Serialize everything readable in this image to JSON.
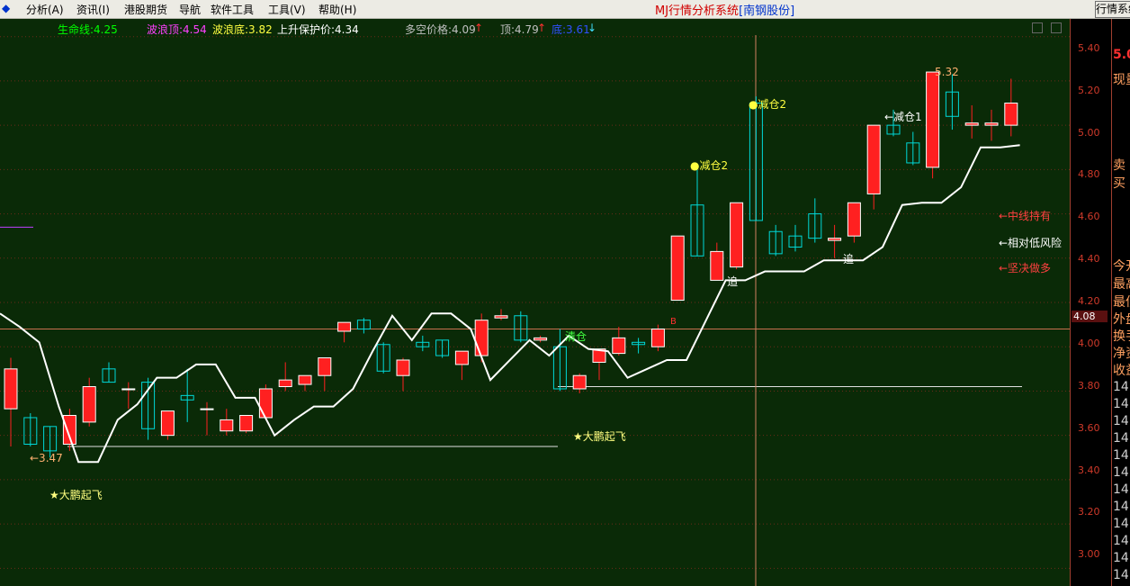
{
  "menu": {
    "items": [
      "分析(A)",
      "资讯(I)",
      "港股期货",
      "导航",
      "软件工具",
      "工具(V)",
      "帮助(H)"
    ],
    "title_system": "MJ行情分析系统",
    "title_stock": "[南钢股份]",
    "right_button": "行情系统"
  },
  "indicators": {
    "life_line": "生命线:4.25",
    "wave_top": "波浪顶:4.54",
    "wave_bottom": "波浪底:3.82",
    "protect_price": "上升保护价:4.34",
    "bull_bear": "多空价格:4.09",
    "bull_bear_arrow": "↑",
    "top": "顶:4.79",
    "top_arrow": "↑",
    "bottom": "底:3.61",
    "bottom_arrow": "↓"
  },
  "colors": {
    "background": "#0a2a07",
    "up": "#ff2020",
    "down": "#00d8d8",
    "life_line": "#ffffff",
    "grid": "#6a2a18"
  },
  "price_axis": {
    "ticks": [
      "5.40",
      "5.20",
      "5.00",
      "4.80",
      "4.60",
      "4.40",
      "4.20",
      "4.00",
      "3.80",
      "3.60",
      "3.40",
      "3.20",
      "3.00"
    ],
    "current_price": "4.08"
  },
  "annotations": {
    "low_label": "←3.47",
    "high_label": "5.32",
    "reduce2_a": "●减仓2",
    "reduce2_b": "●减仓2",
    "reduce1": "←减仓1",
    "clear_pos": "清仓",
    "chase_a": "追",
    "chase_b": "追",
    "b_marker": "B",
    "dapeng_a": "★大鹏起飞",
    "dapeng_b": "★大鹏起飞",
    "mid_hold": "←中线持有",
    "low_risk": "←相对低风险",
    "go_long": "←坚决做多"
  },
  "side_panel": {
    "items": [
      "5.0",
      "现量",
      "卖",
      "买",
      "今开",
      "最高",
      "最低",
      "外盘",
      "换手",
      "净资",
      "收益",
      "14:",
      "14:",
      "14:",
      "14:",
      "14:",
      "14:",
      "14:",
      "14:",
      "14:",
      "14:",
      "14:",
      "14:"
    ]
  },
  "chart_data": {
    "type": "candlestick",
    "ylim": [
      2.92,
      5.48
    ],
    "candles": [
      {
        "o": 3.72,
        "h": 3.95,
        "l": 3.55,
        "c": 3.9
      },
      {
        "o": 3.68,
        "h": 3.7,
        "l": 3.55,
        "c": 3.56
      },
      {
        "o": 3.64,
        "h": 3.64,
        "l": 3.5,
        "c": 3.53
      },
      {
        "o": 3.56,
        "h": 3.72,
        "l": 3.53,
        "c": 3.69
      },
      {
        "o": 3.66,
        "h": 3.86,
        "l": 3.64,
        "c": 3.82
      },
      {
        "o": 3.9,
        "h": 3.93,
        "l": 3.84,
        "c": 3.84
      },
      {
        "o": 3.81,
        "h": 3.84,
        "l": 3.72,
        "c": 3.81
      },
      {
        "o": 3.84,
        "h": 3.86,
        "l": 3.58,
        "c": 3.63
      },
      {
        "o": 3.6,
        "h": 3.7,
        "l": 3.58,
        "c": 3.71
      },
      {
        "o": 3.78,
        "h": 3.9,
        "l": 3.66,
        "c": 3.76
      },
      {
        "o": 3.72,
        "h": 3.75,
        "l": 3.6,
        "c": 3.72
      },
      {
        "o": 3.62,
        "h": 3.72,
        "l": 3.6,
        "c": 3.67
      },
      {
        "o": 3.62,
        "h": 3.68,
        "l": 3.61,
        "c": 3.69
      },
      {
        "o": 3.68,
        "h": 3.83,
        "l": 3.67,
        "c": 3.81
      },
      {
        "o": 3.82,
        "h": 3.93,
        "l": 3.8,
        "c": 3.85
      },
      {
        "o": 3.83,
        "h": 3.86,
        "l": 3.8,
        "c": 3.87
      },
      {
        "o": 3.87,
        "h": 3.95,
        "l": 3.8,
        "c": 3.95
      },
      {
        "o": 4.07,
        "h": 4.1,
        "l": 4.02,
        "c": 4.11
      },
      {
        "o": 4.12,
        "h": 4.13,
        "l": 4.06,
        "c": 4.08
      },
      {
        "o": 4.01,
        "h": 4.02,
        "l": 3.88,
        "c": 3.89
      },
      {
        "o": 3.87,
        "h": 3.95,
        "l": 3.8,
        "c": 3.94
      },
      {
        "o": 4.02,
        "h": 4.05,
        "l": 3.98,
        "c": 4.0
      },
      {
        "o": 4.03,
        "h": 4.03,
        "l": 3.95,
        "c": 3.96
      },
      {
        "o": 3.92,
        "h": 3.95,
        "l": 3.85,
        "c": 3.98
      },
      {
        "o": 3.96,
        "h": 4.15,
        "l": 3.93,
        "c": 4.12
      },
      {
        "o": 4.13,
        "h": 4.17,
        "l": 4.12,
        "c": 4.14
      },
      {
        "o": 4.14,
        "h": 4.16,
        "l": 4.02,
        "c": 4.03
      },
      {
        "o": 4.03,
        "h": 4.05,
        "l": 4.02,
        "c": 4.04
      },
      {
        "o": 4.0,
        "h": 4.08,
        "l": 3.8,
        "c": 3.81
      },
      {
        "o": 3.81,
        "h": 3.88,
        "l": 3.79,
        "c": 3.87
      },
      {
        "o": 3.93,
        "h": 3.98,
        "l": 3.85,
        "c": 3.99
      },
      {
        "o": 3.97,
        "h": 4.09,
        "l": 3.96,
        "c": 4.04
      },
      {
        "o": 4.02,
        "h": 4.04,
        "l": 3.97,
        "c": 4.01
      },
      {
        "o": 4.0,
        "h": 4.1,
        "l": 3.98,
        "c": 4.08
      },
      {
        "o": 4.21,
        "h": 4.28,
        "l": 4.21,
        "c": 4.5
      },
      {
        "o": 4.64,
        "h": 4.8,
        "l": 4.41,
        "c": 4.41
      },
      {
        "o": 4.3,
        "h": 4.47,
        "l": 4.3,
        "c": 4.43
      },
      {
        "o": 4.36,
        "h": 4.64,
        "l": 4.35,
        "c": 4.65
      },
      {
        "o": 5.1,
        "h": 5.13,
        "l": 4.57,
        "c": 4.57
      },
      {
        "o": 4.52,
        "h": 4.55,
        "l": 4.41,
        "c": 4.42
      },
      {
        "o": 4.5,
        "h": 4.55,
        "l": 4.43,
        "c": 4.45
      },
      {
        "o": 4.6,
        "h": 4.67,
        "l": 4.47,
        "c": 4.49
      },
      {
        "o": 4.48,
        "h": 4.55,
        "l": 4.4,
        "c": 4.49
      },
      {
        "o": 4.5,
        "h": 4.65,
        "l": 4.47,
        "c": 4.65
      },
      {
        "o": 4.69,
        "h": 4.75,
        "l": 4.62,
        "c": 5.0
      },
      {
        "o": 5.0,
        "h": 5.07,
        "l": 4.95,
        "c": 4.96
      },
      {
        "o": 4.92,
        "h": 4.97,
        "l": 4.82,
        "c": 4.83
      },
      {
        "o": 4.81,
        "h": 5.23,
        "l": 4.76,
        "c": 5.24
      },
      {
        "o": 5.15,
        "h": 5.23,
        "l": 4.98,
        "c": 5.04
      },
      {
        "o": 5.0,
        "h": 5.09,
        "l": 4.94,
        "c": 5.01
      },
      {
        "o": 5.0,
        "h": 5.07,
        "l": 4.93,
        "c": 5.01
      },
      {
        "o": 5.0,
        "h": 5.21,
        "l": 4.95,
        "c": 5.1
      }
    ],
    "life_line": [
      4.15,
      4.09,
      4.02,
      3.73,
      3.48,
      3.48,
      3.67,
      3.74,
      3.86,
      3.86,
      3.92,
      3.92,
      3.77,
      3.77,
      3.6,
      3.67,
      3.73,
      3.73,
      3.81,
      3.98,
      4.14,
      4.03,
      4.15,
      4.15,
      4.08,
      3.85,
      3.94,
      4.03,
      3.96,
      4.05,
      3.99,
      3.98,
      3.86,
      3.9,
      3.94,
      3.94,
      4.12,
      4.3,
      4.3,
      4.34,
      4.34,
      4.34,
      4.39,
      4.39,
      4.39,
      4.45,
      4.64,
      4.65,
      4.65,
      4.72,
      4.9,
      4.9,
      4.91
    ],
    "support_line_1": 3.55,
    "support_line_2": 3.82,
    "current_price": 4.08
  }
}
